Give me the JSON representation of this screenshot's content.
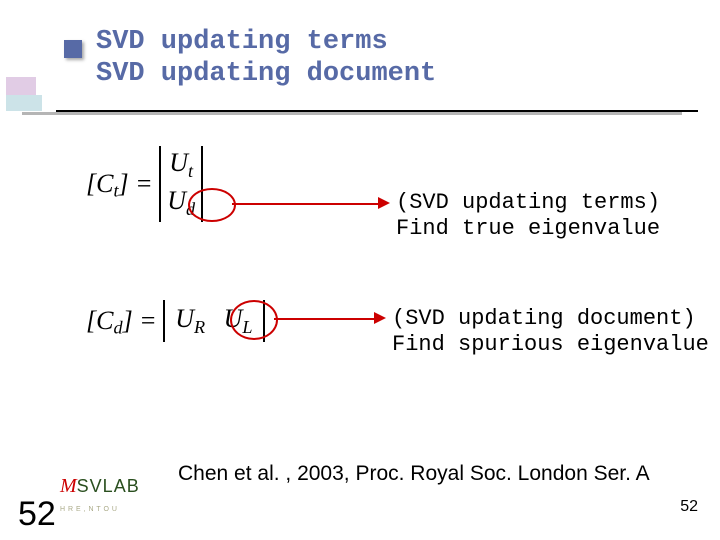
{
  "title": {
    "line1": "SVD updating terms",
    "line2": "SVD updating document"
  },
  "equations": {
    "eq1": "[C_t] = [ U_t ; U_d ]",
    "eq2": "[C_d] = [ U_R  U_L ]"
  },
  "annotations": {
    "a1": {
      "l1": "(SVD updating terms)",
      "l2": "Find true eigenvalue"
    },
    "a2": {
      "l1": "(SVD updating document)",
      "l2": "Find spurious eigenvalue"
    }
  },
  "citation": "Chen et al. , 2003, Proc. Royal Soc. London Ser. A",
  "page": {
    "big": "52",
    "small": "52"
  },
  "colors": {
    "accent": "#576aa6",
    "mark": "#cc0000"
  }
}
